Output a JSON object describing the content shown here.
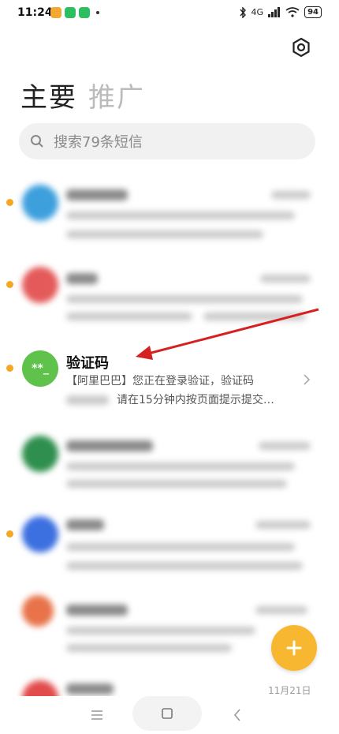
{
  "status_bar": {
    "time": "11:24",
    "network": "4G",
    "battery": "94"
  },
  "header": {
    "tab_main": "主要",
    "tab_promo": "推广",
    "settings_icon": "gear-icon"
  },
  "search": {
    "placeholder": "搜索79条短信"
  },
  "messages": [
    {
      "sender": "",
      "preview": "",
      "avatar_color": "#3d9fdc",
      "unread": true
    },
    {
      "sender": "",
      "preview": "",
      "avatar_color": "#e45a5a",
      "unread": true
    },
    {
      "sender": "验证码",
      "preview_line1": "【阿里巴巴】您正在登录验证，验证码",
      "preview_line2": "请在15分钟内按页面提示提交…",
      "avatar_text": "**_",
      "avatar_color": "#5ec24b",
      "unread": true
    },
    {
      "sender": "",
      "preview": "",
      "avatar_color": "#2f8f4e",
      "unread": false
    },
    {
      "sender": "",
      "preview": "",
      "avatar_color": "#3c6fe0",
      "unread": true
    },
    {
      "sender": "",
      "preview": "",
      "avatar_color": "#e8734a",
      "unread": false
    },
    {
      "sender": "",
      "preview": "11月21日",
      "avatar_color": "#e24b4b",
      "unread": false
    }
  ],
  "colors": {
    "unread_dot": "#f5a623",
    "fab": "#f7b730",
    "annotation_arrow": "#d52121"
  }
}
